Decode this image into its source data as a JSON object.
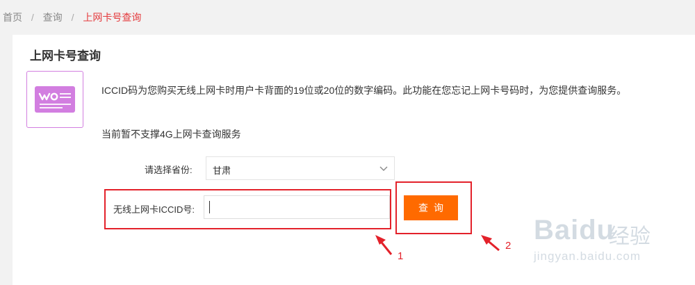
{
  "breadcrumb": {
    "home": "首页",
    "query": "查询",
    "current": "上网卡号查询",
    "separator": "/"
  },
  "page": {
    "title": "上网卡号查询",
    "description": "ICCID码为您购买无线上网卡时用户卡背面的19位或20位的数字编码。此功能在您忘记上网卡号码时，为您提供查询服务。",
    "notice": "当前暂不支撑4G上网卡查询服务"
  },
  "form": {
    "province_label": "请选择省份:",
    "province_value": "甘肃",
    "iccid_label": "无线上网卡ICCID号:",
    "iccid_value": "",
    "query_button": "查询"
  },
  "annotations": {
    "step1": "1",
    "step2": "2"
  },
  "watermark": {
    "logo": "Baidu",
    "cn": "经验",
    "url": "jingyan.baidu.com"
  },
  "colors": {
    "accent_orange": "#ff6a00",
    "breadcrumb_current": "#e4393c",
    "icon_purple": "#d27ee0",
    "annotation_red": "#e3212a"
  },
  "icons": [
    "card-icon",
    "chevron-down-icon",
    "arrow-icon"
  ]
}
